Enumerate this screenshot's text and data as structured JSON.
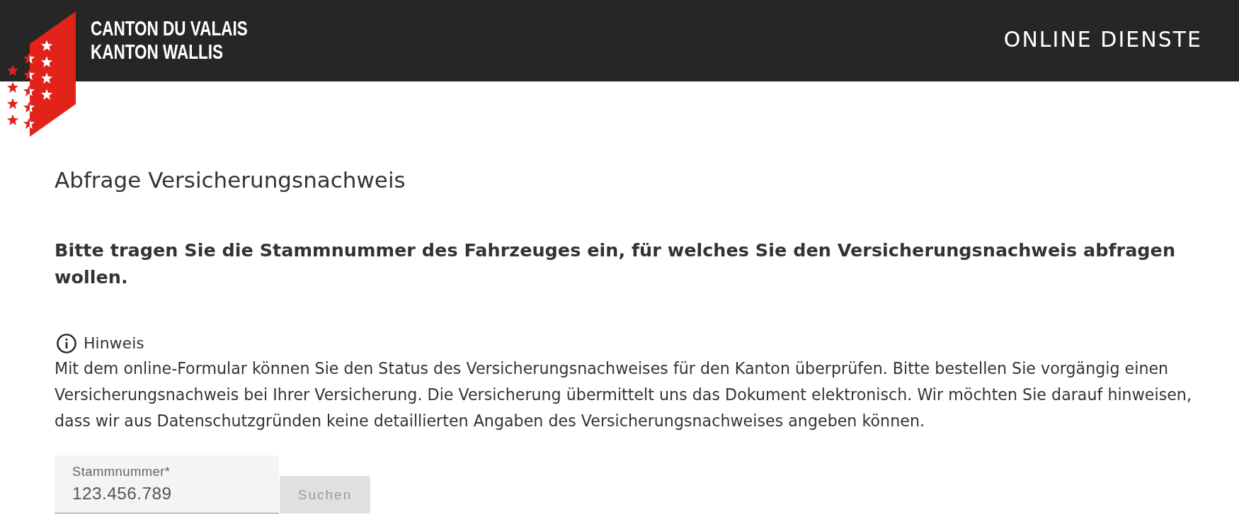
{
  "header": {
    "logo_lines": [
      "CANTON DU VALAIS",
      "KANTON WALLIS"
    ],
    "title": "ONLINE DIENSTE"
  },
  "page_title": "Abfrage Versicherungsnachweis",
  "instruction": "Bitte tragen Sie die Stammnummer des Fahrzeuges ein, für welches Sie den Versicherungsnachweis abfragen wollen.",
  "notice": {
    "label": "Hinweis",
    "text": "Mit dem online-Formular können Sie den Status des Versicherungsnachweises für den Kanton überprüfen. Bitte bestellen Sie vorgängig einen Versicherungsnachweis bei Ihrer Versicherung. Die Versicherung übermittelt uns das Dokument elektronisch. Wir möchten Sie darauf hinweisen, dass wir aus Datenschutzgründen keine detaillierten Angaben des Versicherungsnachweises angeben können."
  },
  "form": {
    "field": {
      "label": "Stammnummer*",
      "value": "123.456.789"
    },
    "button": {
      "label": "Suchen",
      "disabled": true
    }
  }
}
